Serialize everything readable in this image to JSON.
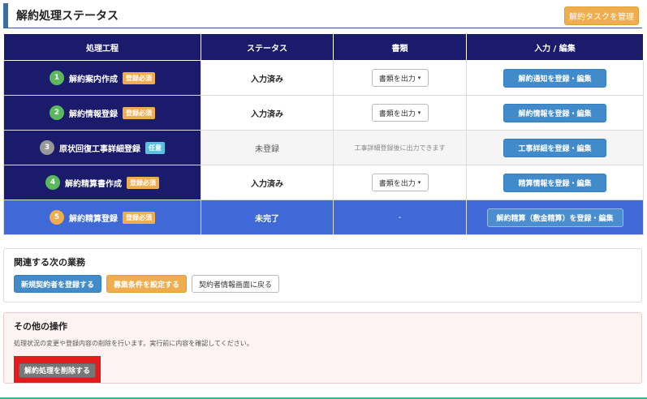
{
  "header": {
    "title": "解約処理ステータス",
    "manage_button": "解約タスクを管理"
  },
  "table": {
    "columns": [
      "処理工程",
      "ステータス",
      "書類",
      "入力 / 編集"
    ],
    "rows": [
      {
        "num": "1",
        "num_color": "#5cb85c",
        "step": "解約案内作成",
        "badge": "登録必須",
        "badge_color": "#f0ad4e",
        "status": "入力済み",
        "docs": "書類を出力",
        "action": "解約通知を登録・編集"
      },
      {
        "num": "2",
        "num_color": "#5cb85c",
        "step": "解約情報登録",
        "badge": "登録必須",
        "badge_color": "#f0ad4e",
        "status": "入力済み",
        "docs": "書類を出力",
        "action": "解約情報を登録・編集"
      },
      {
        "num": "3",
        "num_color": "#999999",
        "step": "原状回復工事詳細登録",
        "badge": "任意",
        "badge_color": "#5bc0de",
        "status": "未登録",
        "docs_note": "工事詳細登録後に出力できます",
        "action": "工事詳細を登録・編集"
      },
      {
        "num": "4",
        "num_color": "#5cb85c",
        "step": "解約精算書作成",
        "badge": "登録必須",
        "badge_color": "#f0ad4e",
        "status": "入力済み",
        "docs": "書類を出力",
        "action": "精算情報を登録・編集"
      },
      {
        "num": "5",
        "num_color": "#f0ad4e",
        "step": "解約精算登録",
        "badge": "登録必須",
        "badge_color": "#f0ad4e",
        "status": "未完了",
        "docs_note": "-",
        "action": "解約精算（敷金精算）を登録・編集"
      }
    ]
  },
  "related": {
    "title": "関連する次の業務",
    "buttons": [
      "新規契約者を登録する",
      "募集条件を設定する",
      "契約者情報画面に戻る"
    ]
  },
  "other": {
    "title": "その他の操作",
    "description": "処理状況の変更や登録内容の削除を行います。実行前に内容を確認してください。",
    "delete_button": "解約処理を削除する"
  },
  "icons": {
    "caret": "▾"
  },
  "colors": {
    "table_header": "#1b1b6b",
    "highlight_row": "#3f69d6",
    "primary": "#428bca",
    "warning": "#f0ad4e",
    "danger_frame": "#e31b1b"
  }
}
